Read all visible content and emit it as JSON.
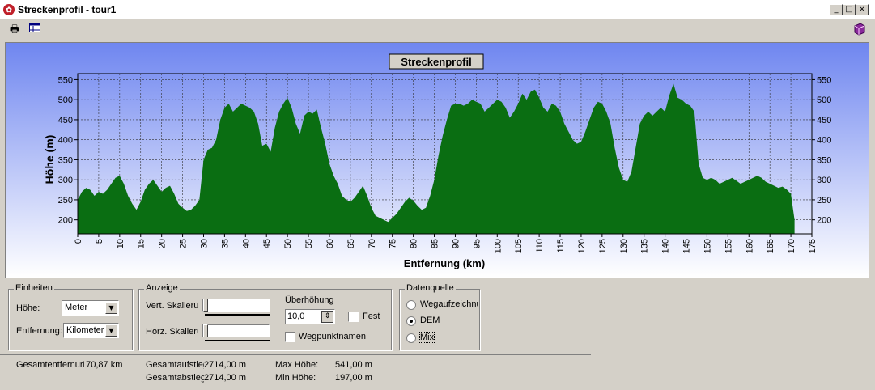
{
  "window": {
    "title": "Streckenprofil - tour1"
  },
  "chart_data": {
    "type": "area",
    "title": "Streckenprofil",
    "xlabel": "Entfernung (km)",
    "ylabel": "Höhe (m)",
    "xlim": [
      0,
      175
    ],
    "ylim": [
      165,
      565
    ],
    "xticks": [
      0,
      5,
      10,
      15,
      20,
      25,
      30,
      35,
      40,
      45,
      50,
      55,
      60,
      65,
      70,
      75,
      80,
      85,
      90,
      95,
      100,
      105,
      110,
      115,
      120,
      125,
      130,
      135,
      140,
      145,
      150,
      155,
      160,
      165,
      170,
      175
    ],
    "yticks": [
      200,
      250,
      300,
      350,
      400,
      450,
      500,
      550
    ],
    "grid": true,
    "colors": {
      "fill": "#0a6e12",
      "background_top": "#6f86f0",
      "background_bottom": "#ffffff"
    },
    "series": [
      {
        "x": [
          0,
          1,
          2,
          3,
          4,
          5,
          6,
          7,
          8,
          9,
          10,
          11,
          12,
          13,
          14,
          15,
          16,
          17,
          18,
          19,
          20,
          21,
          22,
          23,
          24,
          25,
          26,
          27,
          28,
          29,
          30,
          31,
          32,
          33,
          34,
          35,
          36,
          37,
          38,
          39,
          40,
          41,
          42,
          43,
          44,
          45,
          46,
          47,
          48,
          49,
          50,
          51,
          52,
          53,
          54,
          55,
          56,
          57,
          58,
          59,
          60,
          61,
          62,
          63,
          64,
          65,
          66,
          67,
          68,
          69,
          70,
          71,
          72,
          73,
          74,
          75,
          76,
          77,
          78,
          79,
          80,
          81,
          82,
          83,
          84,
          85,
          86,
          87,
          88,
          89,
          90,
          91,
          92,
          93,
          94,
          95,
          96,
          97,
          98,
          99,
          100,
          101,
          102,
          103,
          104,
          105,
          106,
          107,
          108,
          109,
          110,
          111,
          112,
          113,
          114,
          115,
          116,
          117,
          118,
          119,
          120,
          121,
          122,
          123,
          124,
          125,
          126,
          127,
          128,
          129,
          130,
          131,
          132,
          133,
          134,
          135,
          136,
          137,
          138,
          139,
          140,
          141,
          142,
          143,
          144,
          145,
          146,
          147,
          148,
          149,
          150,
          151,
          152,
          153,
          154,
          155,
          156,
          157,
          158,
          159,
          160,
          161,
          162,
          163,
          164,
          165,
          166,
          167,
          168,
          169,
          170,
          170.87
        ],
        "y": [
          250,
          270,
          280,
          275,
          260,
          270,
          265,
          275,
          290,
          305,
          310,
          290,
          260,
          240,
          225,
          245,
          275,
          290,
          300,
          285,
          270,
          280,
          285,
          265,
          240,
          230,
          222,
          225,
          235,
          250,
          350,
          375,
          380,
          400,
          450,
          480,
          490,
          470,
          480,
          490,
          485,
          480,
          470,
          440,
          385,
          390,
          370,
          430,
          470,
          490,
          505,
          480,
          440,
          415,
          460,
          470,
          465,
          475,
          430,
          390,
          340,
          310,
          290,
          260,
          250,
          245,
          255,
          270,
          285,
          260,
          230,
          210,
          205,
          200,
          195,
          205,
          215,
          230,
          245,
          255,
          248,
          235,
          225,
          230,
          260,
          300,
          360,
          410,
          450,
          485,
          490,
          490,
          485,
          490,
          500,
          495,
          490,
          470,
          480,
          490,
          500,
          495,
          480,
          455,
          470,
          490,
          515,
          500,
          520,
          525,
          505,
          480,
          470,
          490,
          485,
          470,
          440,
          420,
          400,
          390,
          395,
          420,
          450,
          480,
          495,
          490,
          470,
          440,
          380,
          330,
          300,
          295,
          320,
          380,
          440,
          460,
          470,
          460,
          470,
          480,
          470,
          510,
          540,
          505,
          500,
          490,
          485,
          470,
          340,
          305,
          300,
          305,
          300,
          290,
          295,
          300,
          305,
          298,
          290,
          295,
          300,
          305,
          310,
          305,
          295,
          290,
          285,
          280,
          283,
          276,
          265,
          200
        ]
      }
    ]
  },
  "panels": {
    "einheiten": {
      "title": "Einheiten",
      "hoehe_label": "Höhe:",
      "hoehe_value": "Meter",
      "entfernung_label": "Entfernung:",
      "entfernung_value": "Kilometer"
    },
    "anzeige": {
      "title": "Anzeige",
      "vert_label": "Vert. Skalierung",
      "horz_label": "Horz. Skalierung",
      "ueberhoehung_label": "Überhöhung",
      "ueberhoehung_value": "10,0",
      "fest_label": "Fest",
      "wegpunkt_label": "Wegpunktnamen"
    },
    "datenquelle": {
      "title": "Datenquelle",
      "options": [
        "Wegaufzeichnung",
        "DEM",
        "Mix"
      ],
      "selected": "DEM"
    }
  },
  "status": {
    "gesamtentfernung_label": "Gesamtentfernung",
    "gesamtentfernung_value": "170,87 km",
    "gesamtaufstieg_label": "Gesamtaufstieg",
    "gesamtaufstieg_value": "2714,00 m",
    "gesamtabstieg_label": "Gesamtabstieg",
    "gesamtabstieg_value": "2714,00 m",
    "max_hoehe_label": "Max Höhe:",
    "max_hoehe_value": "541,00 m",
    "min_hoehe_label": "Min Höhe:",
    "min_hoehe_value": "197,00 m"
  }
}
